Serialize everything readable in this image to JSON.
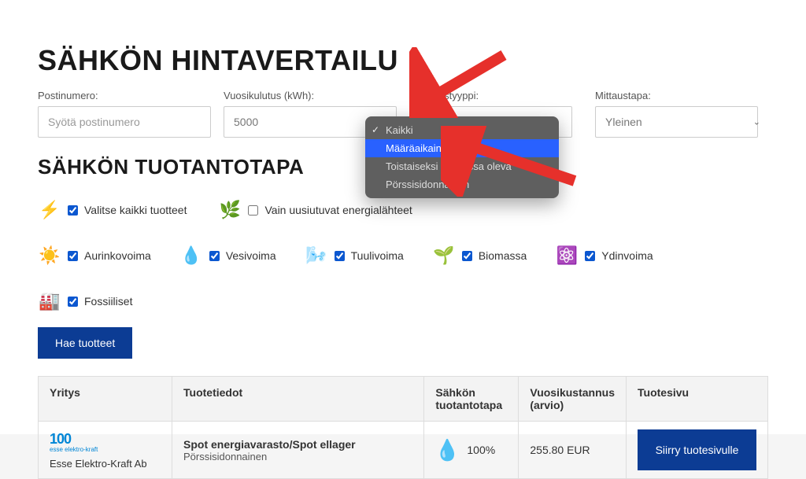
{
  "title": "SÄHKÖN HINTAVERTAILU",
  "filters": {
    "postinumero": {
      "label": "Postinumero:",
      "placeholder": "Syötä postinumero",
      "value": ""
    },
    "vuosikulutus": {
      "label": "Vuosikulutus (kWh):",
      "value": "5000"
    },
    "sopimustyyppi": {
      "label": "Sopimustyyppi:",
      "options": [
        {
          "label": "Kaikki",
          "selected": true
        },
        {
          "label": "Määräaikainen",
          "highlight": true
        },
        {
          "label": "Toistaiseksi voimassa oleva"
        },
        {
          "label": "Pörssisidonnainen"
        }
      ]
    },
    "mittaustapa": {
      "label": "Mittaustapa:",
      "value": "Yleinen"
    }
  },
  "section2_title": "SÄHKÖN TUOTANTOTAPA",
  "energy_all": {
    "label": "Valitse kaikki tuotteet",
    "checked": true
  },
  "energy_renewable": {
    "label": "Vain uusiutuvat energialähteet",
    "checked": false
  },
  "energies": [
    {
      "label": "Aurinkovoima",
      "checked": true,
      "icon": "☀️"
    },
    {
      "label": "Vesivoima",
      "checked": true,
      "icon": "💧"
    },
    {
      "label": "Tuulivoima",
      "checked": true,
      "icon": "🌬️"
    },
    {
      "label": "Biomassa",
      "checked": true,
      "icon": "🌱"
    },
    {
      "label": "Ydinvoima",
      "checked": true,
      "icon": "⚛️"
    },
    {
      "label": "Fossiiliset",
      "checked": true,
      "icon": "🏭"
    }
  ],
  "search_btn": "Hae tuotteet",
  "table": {
    "headers": {
      "yritys": "Yritys",
      "tuotetiedot": "Tuotetiedot",
      "tuotantotapa": "Sähkön tuotantotapa",
      "kustannus": "Vuosikustannus (arvio)",
      "tuotesivu": "Tuotesivu"
    },
    "rows": [
      {
        "company_logo_text": "100",
        "company_logo_sub": "esse elektro-kraft",
        "company_name": "Esse Elektro-Kraft Ab",
        "product_name": "Spot energiavarasto/Spot ellager",
        "product_type": "Pörssisidonnainen",
        "production_pct": "100%",
        "cost": "255.80 EUR",
        "goto_label": "Siirry tuotesivulle"
      }
    ]
  },
  "colors": {
    "accent": "#0c3c94",
    "highlight": "#2961ff",
    "arrow": "#e6302b"
  }
}
